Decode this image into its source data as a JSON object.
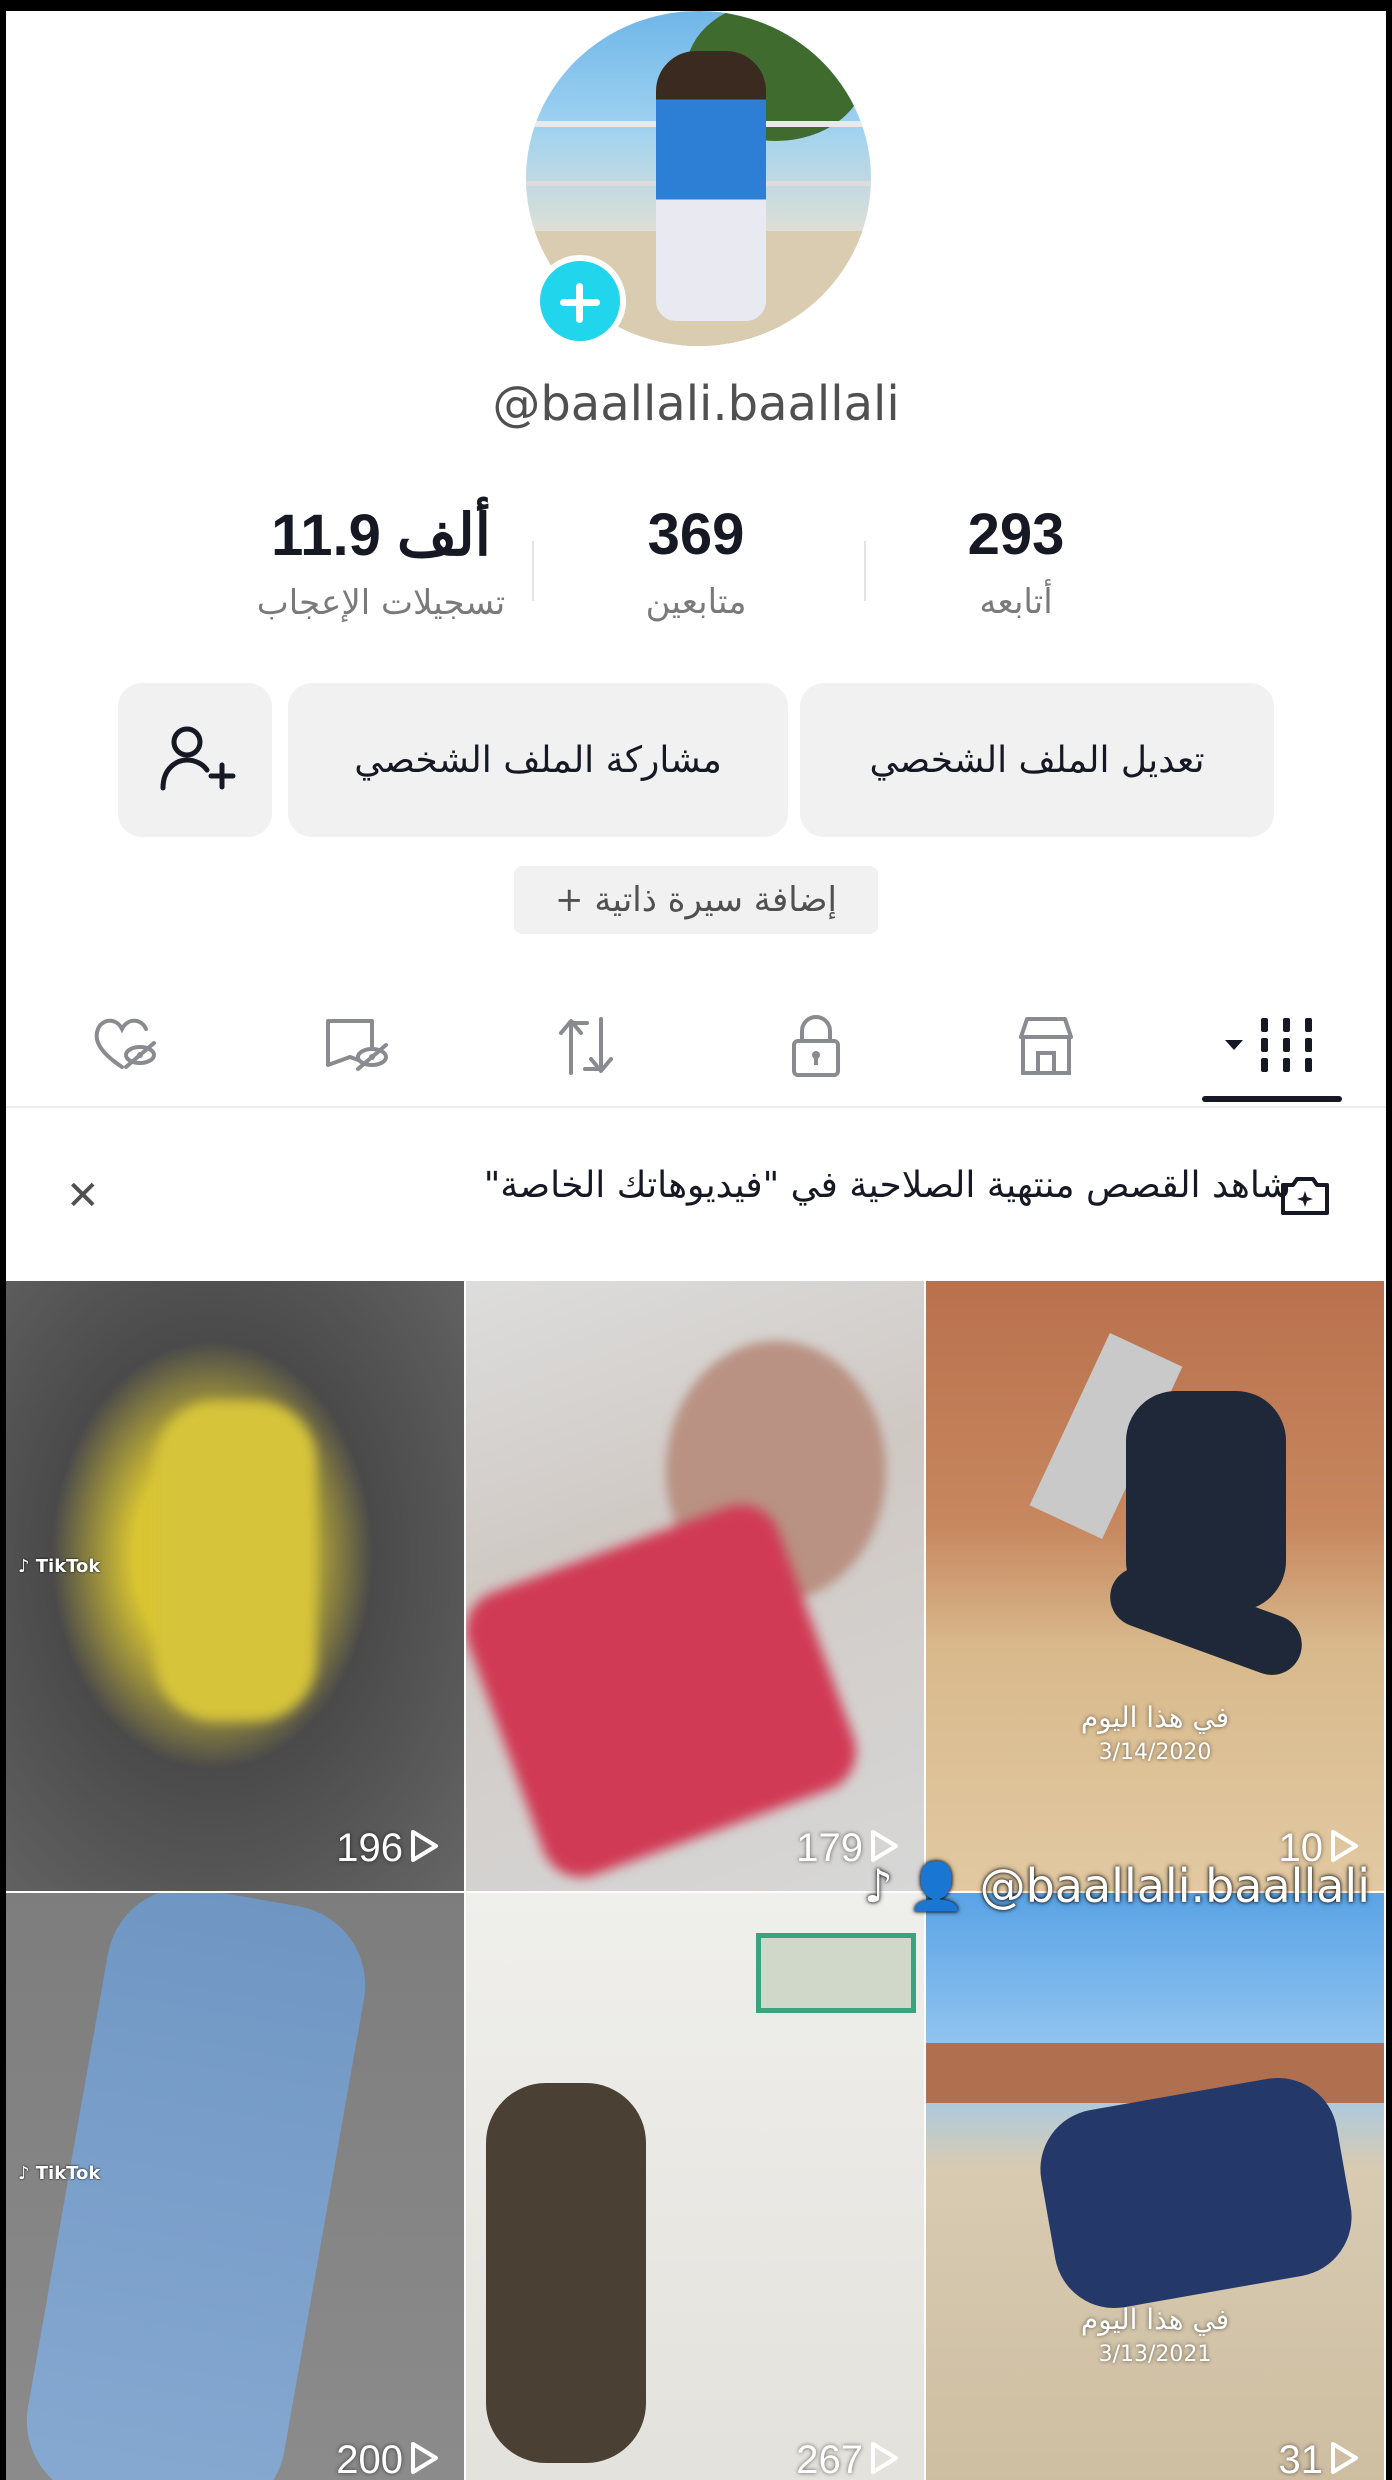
{
  "profile": {
    "username": "@baallali.baallali",
    "stats": {
      "following_value": "293",
      "following_label": "أتابعه",
      "followers_value": "369",
      "followers_label": "متابعين",
      "likes_value": "11.9 ألف",
      "likes_label": "تسجيلات الإعجاب"
    }
  },
  "actions": {
    "edit_label": "تعديل الملف الشخصي",
    "share_label": "مشاركة الملف الشخصي",
    "add_bio_label": "+ إضافة سيرة ذاتية"
  },
  "tabs": [
    {
      "icon": "videos-grid-icon"
    },
    {
      "icon": "shop-icon"
    },
    {
      "icon": "lock-icon"
    },
    {
      "icon": "repost-icon"
    },
    {
      "icon": "favorites-hidden-icon"
    },
    {
      "icon": "liked-hidden-icon"
    }
  ],
  "banner": {
    "text": "شاهد القصص منتهية الصلاحية في \"فيديوهاتك الخاصة\""
  },
  "videos": [
    {
      "views": "196"
    },
    {
      "views": "179"
    },
    {
      "views": "10",
      "overlay_title": "في هذا اليوم",
      "overlay_date": "3/14/2020"
    },
    {
      "views": "200"
    },
    {
      "views": "267"
    },
    {
      "views": "31",
      "overlay_title": "في هذا اليوم",
      "overlay_date": "3/13/2021"
    }
  ],
  "watermark": "@baallali.baallali",
  "colors": {
    "accent": "#20d5ec",
    "button_bg": "#f1f1f2",
    "text_primary": "#161823",
    "text_secondary": "#7a7a7a"
  }
}
